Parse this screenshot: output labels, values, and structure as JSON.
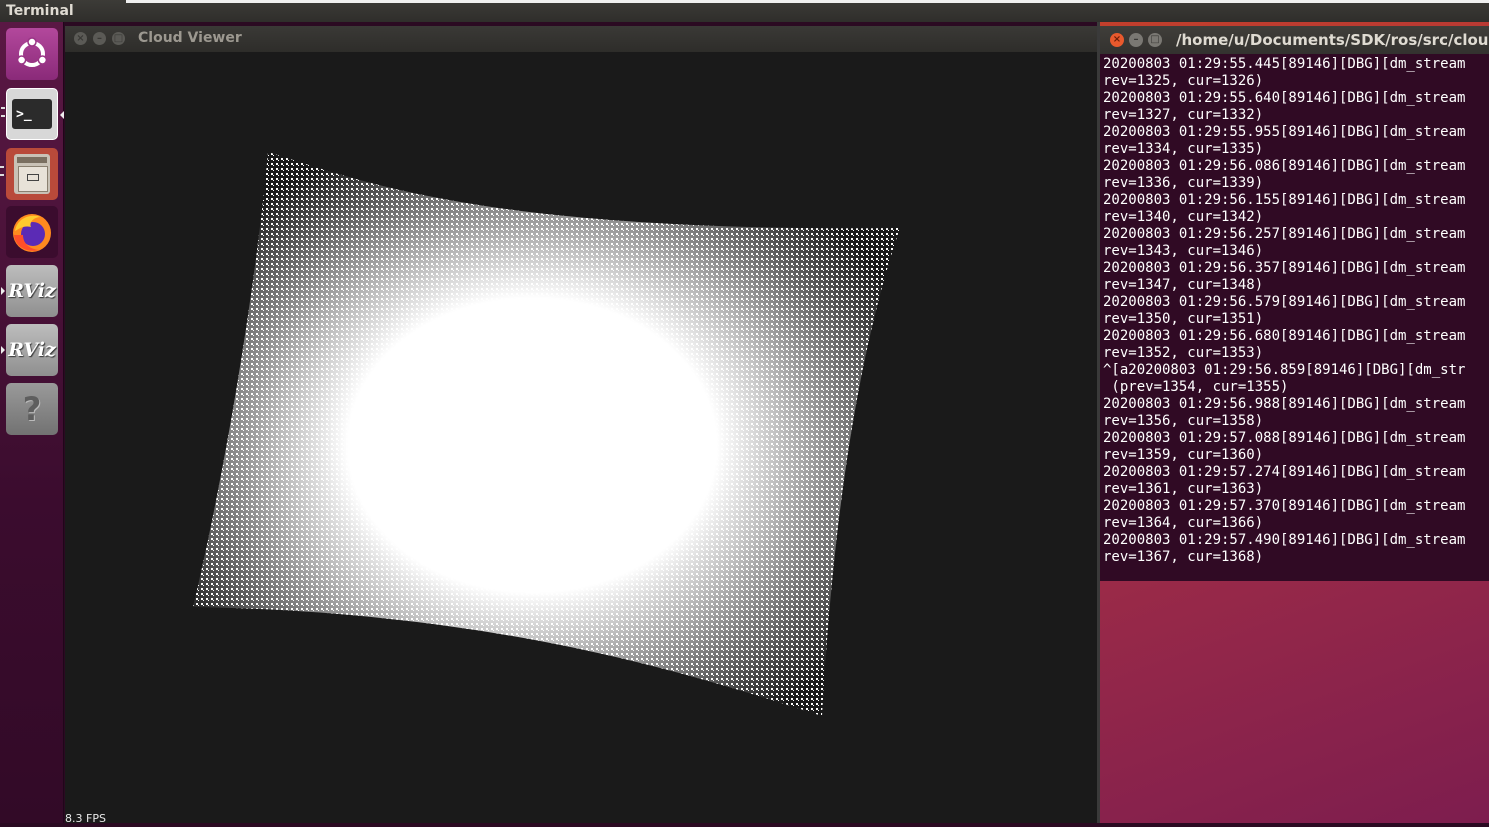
{
  "top_panel": {
    "title": "Terminal"
  },
  "launcher": {
    "items": [
      {
        "name": "ubuntu-dash",
        "label": ""
      },
      {
        "name": "terminal",
        "label": ">_"
      },
      {
        "name": "files",
        "label": ""
      },
      {
        "name": "firefox",
        "label": ""
      },
      {
        "name": "rviz-1",
        "label": "RViz"
      },
      {
        "name": "rviz-2",
        "label": "RViz"
      },
      {
        "name": "unknown-app",
        "label": "?"
      }
    ]
  },
  "cloud_viewer": {
    "title": "Cloud Viewer",
    "fps": "8.3 FPS",
    "colors": {
      "background": "#1a1a1a",
      "points": "#ffffff"
    }
  },
  "terminal": {
    "title": "/home/u/Documents/SDK/ros/src/cloud_vie",
    "lines": [
      "20200803 01:29:55.445[89146][DBG][dm_stream",
      "rev=1325, cur=1326)",
      "20200803 01:29:55.640[89146][DBG][dm_stream",
      "rev=1327, cur=1332)",
      "20200803 01:29:55.955[89146][DBG][dm_stream",
      "rev=1334, cur=1335)",
      "20200803 01:29:56.086[89146][DBG][dm_stream",
      "rev=1336, cur=1339)",
      "20200803 01:29:56.155[89146][DBG][dm_stream",
      "rev=1340, cur=1342)",
      "20200803 01:29:56.257[89146][DBG][dm_stream",
      "rev=1343, cur=1346)",
      "20200803 01:29:56.357[89146][DBG][dm_stream",
      "rev=1347, cur=1348)",
      "20200803 01:29:56.579[89146][DBG][dm_stream",
      "rev=1350, cur=1351)",
      "20200803 01:29:56.680[89146][DBG][dm_stream",
      "rev=1352, cur=1353)",
      "^[a20200803 01:29:56.859[89146][DBG][dm_str",
      " (prev=1354, cur=1355)",
      "20200803 01:29:56.988[89146][DBG][dm_stream",
      "rev=1356, cur=1358)",
      "20200803 01:29:57.088[89146][DBG][dm_stream",
      "rev=1359, cur=1360)",
      "20200803 01:29:57.274[89146][DBG][dm_stream",
      "rev=1361, cur=1363)",
      "20200803 01:29:57.370[89146][DBG][dm_stream",
      "rev=1364, cur=1366)",
      "20200803 01:29:57.490[89146][DBG][dm_stream",
      "rev=1367, cur=1368)"
    ]
  }
}
